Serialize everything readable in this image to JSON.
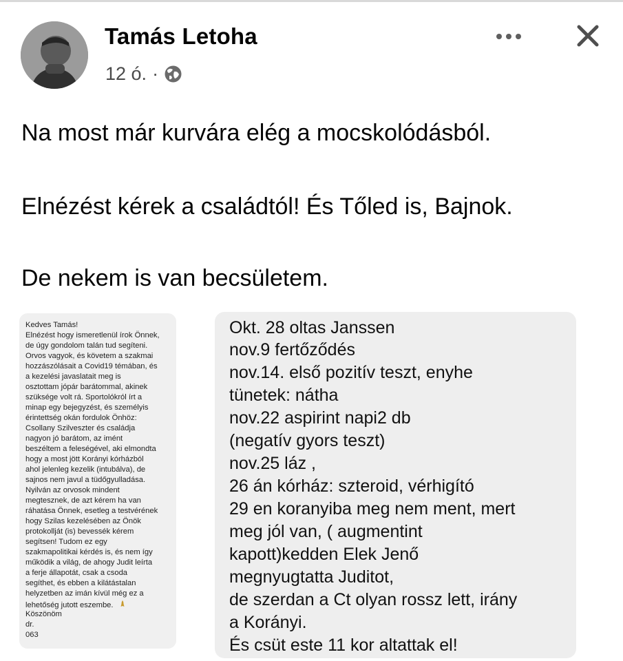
{
  "post": {
    "author_name": "Tamás Letoha",
    "time": "12 ó.",
    "separator": "·",
    "privacy_icon": "globe-icon",
    "more_icon": "more-icon",
    "close_icon": "close-icon",
    "text": [
      "Na most már kurvára elég a mocskolódásból.",
      "Elnézést kérek a családtól! És Tőled is, Bajnok.",
      "De nekem is van becsületem."
    ]
  },
  "attachment": {
    "left_message_lines": [
      "Kedves Tamás!",
      "Elnézést hogy ismeretlenül írok Önnek,",
      "de úgy gondolom talán tud segíteni.",
      "Orvos vagyok, és követem a szakmai",
      "hozzászólásait a Covid19 témában, és",
      "a kezelési javaslatait meg is",
      "osztottam jópár barátommal, akinek",
      "szüksége volt rá. Sportolókról írt a",
      "minap egy bejegyzést, és személyis",
      "érintettség okán fordulok Önhöz:",
      "Csollany Szilveszter és családja",
      "nagyon jó barátom, az imént",
      "beszéltem a feleségével, aki elmondta",
      "hogy a most jött Korányi kórházból",
      "ahol jelenleg kezelik (intubálva), de",
      "sajnos nem javul a tüdőgyulladása.",
      "Nyilván az orvosok mindent",
      "megtesznek, de azt kérem ha van",
      "ráhatása Önnek, esetleg a testvérének",
      "hogy Szilas kezelésében az Önök",
      "protokollját (is) bevessék kérem",
      "segítsen! Tudom ez egy",
      "szakmapolitikai kérdés is, és nem így",
      "működik a világ, de ahogy Judit leírta",
      "a ferje állapotát, csak a csoda",
      "segíthet, és ebben a kilátástalan",
      "helyzetben az imán kívül még ez a",
      "lehetőség jutott eszembe.",
      "Köszönöm",
      "dr.",
      "063"
    ],
    "pray_icon": "pray-icon",
    "right_note_lines": [
      "Okt. 28 oltas Janssen",
      "nov.9 fertőződés",
      "nov.14. első pozitív teszt, enyhe",
      "tünetek: nátha",
      "nov.22 aspirint napi2 db",
      "(negatív gyors teszt)",
      "nov.25 láz ,",
      "26 án kórház: szteroid, vérhigító",
      "29 en koranyiba meg nem ment, mert",
      "meg jól van, ( augmentint",
      "kapott)kedden Elek Jenő",
      "megnyugtatta Juditot,",
      "de szerdan a Ct olyan rossz lett, irány",
      "a Korányi.",
      "És csüt este 11 kor altattak el!"
    ]
  }
}
